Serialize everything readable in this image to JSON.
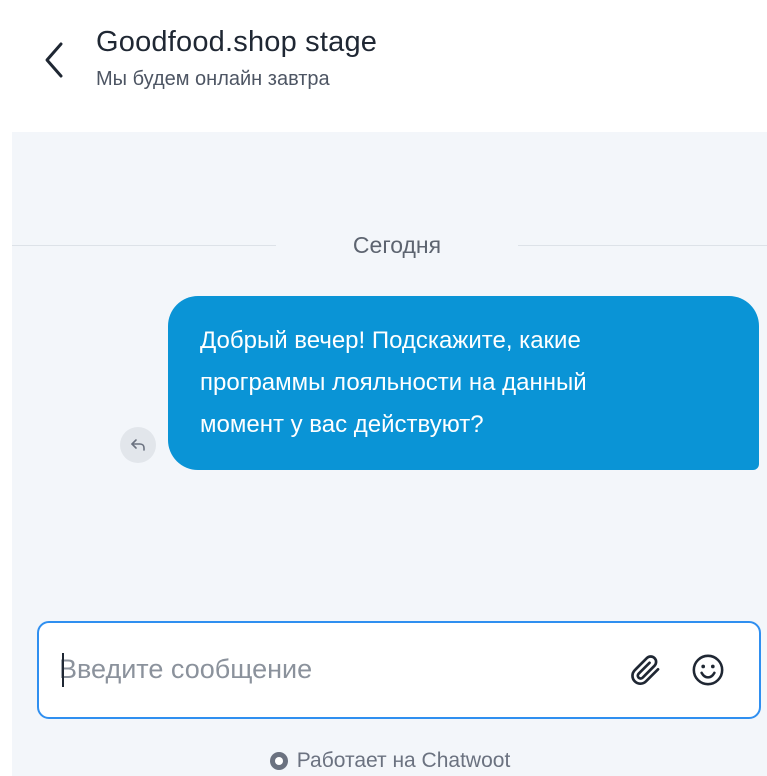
{
  "header": {
    "title": "Goodfood.shop stage",
    "status": "Мы будем онлайн завтра",
    "back_icon": "chevron-left-icon"
  },
  "conversation": {
    "date_separator": "Сегодня",
    "messages": [
      {
        "lines": [
          "Добрый вечер! Подскажите, какие",
          "программы лояльности на данный",
          "момент у вас действуют?"
        ],
        "bubble_color": "#0a94d6"
      }
    ],
    "reply_icon": "reply-icon"
  },
  "composer": {
    "placeholder": "Введите сообщение",
    "attach_icon": "paperclip-icon",
    "emoji_icon": "smiley-icon",
    "border_color": "#2f8ff0"
  },
  "branding": {
    "text": "Работает на Chatwoot",
    "icon": "chatwoot-logo-icon"
  }
}
